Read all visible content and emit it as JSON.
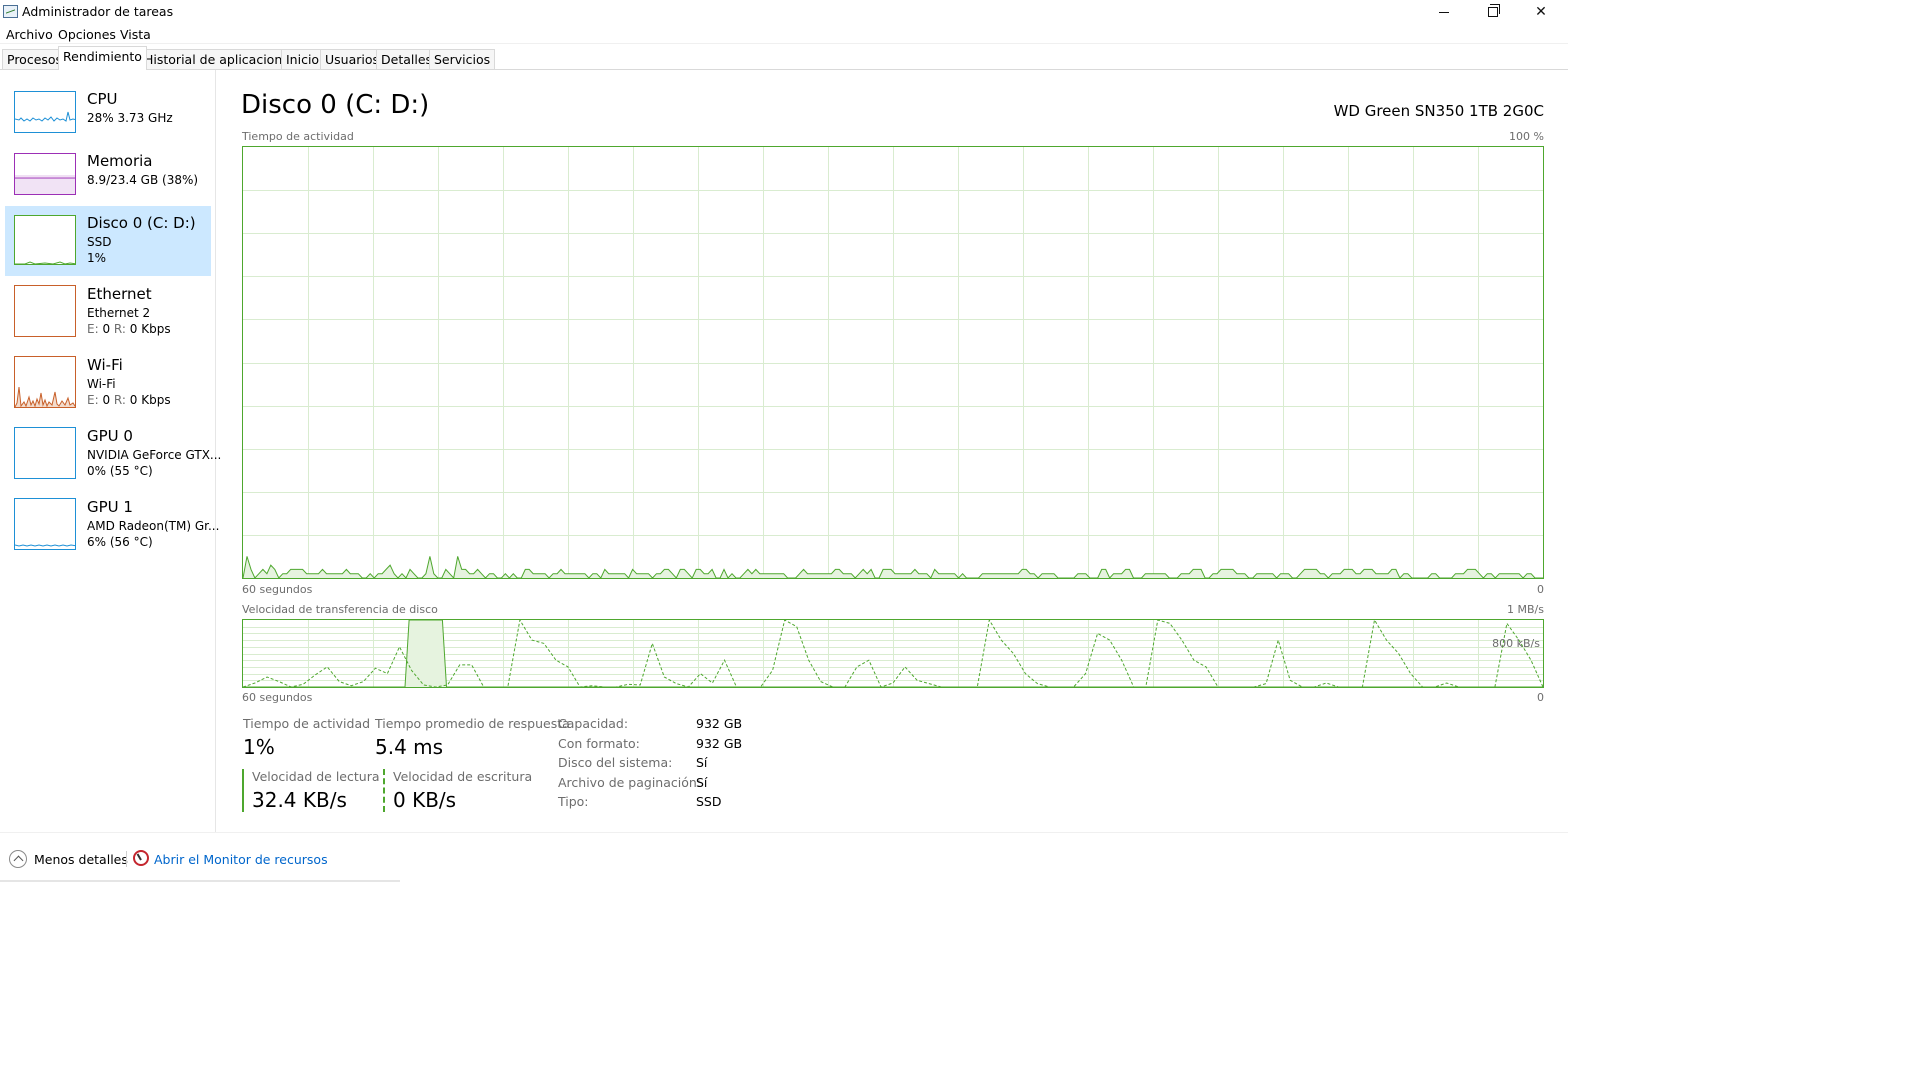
{
  "window": {
    "title": "Administrador de tareas",
    "controls": {
      "minimize": "minimize",
      "restore": "restore",
      "close": "✕"
    }
  },
  "menu": [
    "Archivo",
    "Opciones",
    "Vista"
  ],
  "tabs": [
    "Procesos",
    "Rendimiento",
    "Historial de aplicaciones",
    "Inicio",
    "Usuarios",
    "Detalles",
    "Servicios"
  ],
  "active_tab": "Rendimiento",
  "sidebar": {
    "items": [
      {
        "name": "CPU",
        "line1": "28% 3.73 GHz",
        "color": "#1e90d6"
      },
      {
        "name": "Memoria",
        "line1": "8.9/23.4 GB (38%)",
        "color": "#9c2fb6"
      },
      {
        "name": "Disco 0 (C: D:)",
        "line1": "SSD",
        "line2": "1%",
        "color": "#4ea72e"
      },
      {
        "name": "Ethernet",
        "line1": "Ethernet 2",
        "line2_prefix_e": "E:",
        "line2_e": "0",
        "line2_prefix_r": "R:",
        "line2_r": "0 Kbps",
        "color": "#c8602a"
      },
      {
        "name": "Wi-Fi",
        "line1": "Wi-Fi",
        "line2_prefix_e": "E:",
        "line2_e": "0",
        "line2_prefix_r": "R:",
        "line2_r": "0 Kbps",
        "color": "#c8602a"
      },
      {
        "name": "GPU 0",
        "line1": "NVIDIA GeForce GTX...",
        "line2": "0%  (55 °C)",
        "color": "#1e90d6"
      },
      {
        "name": "GPU 1",
        "line1": "AMD Radeon(TM) Gr...",
        "line2": "6%  (56 °C)",
        "color": "#1e90d6"
      }
    ]
  },
  "main": {
    "title": "Disco 0 (C: D:)",
    "device": "WD Green SN350 1TB 2G0C",
    "chart1": {
      "label": "Tiempo de actividad",
      "max_label": "100 %",
      "time_label": "60 segundos",
      "min_label": "0"
    },
    "chart2": {
      "label": "Velocidad de transferencia de disco",
      "max_label": "1 MB/s",
      "mid_label": "800 kB/s",
      "time_label": "60 segundos",
      "min_label": "0"
    }
  },
  "stats": {
    "active_time_label": "Tiempo de actividad",
    "active_time_value": "1%",
    "response_label": "Tiempo promedio de respuesta",
    "response_value": "5.4 ms",
    "read_label": "Velocidad de lectura",
    "read_value": "32.4 KB/s",
    "write_label": "Velocidad de escritura",
    "write_value": "0 KB/s"
  },
  "properties": [
    {
      "label": "Capacidad:",
      "value": "932 GB"
    },
    {
      "label": "Con formato:",
      "value": "932 GB"
    },
    {
      "label": "Disco del sistema:",
      "value": "Sí"
    },
    {
      "label": "Archivo de paginación:",
      "value": "Sí"
    },
    {
      "label": "Tipo:",
      "value": "SSD"
    }
  ],
  "footer": {
    "fewer_details": "Menos detalles",
    "resource_monitor": "Abrir el Monitor de recursos"
  },
  "chart_data": [
    {
      "type": "area",
      "title": "Tiempo de actividad",
      "ylim": [
        0,
        100
      ],
      "unit": "%",
      "x_span_label": "60 segundos",
      "series": [
        {
          "values": [
            0,
            5,
            2,
            0,
            1,
            2,
            1,
            3,
            2,
            0,
            1,
            1,
            2,
            2,
            2,
            2,
            1,
            1,
            1,
            1,
            2,
            1,
            1,
            1,
            1,
            1,
            2,
            1,
            1,
            1,
            0,
            0,
            1,
            0,
            1,
            1,
            2,
            3,
            1,
            0,
            1,
            0,
            2,
            1,
            0,
            0,
            1,
            5,
            1,
            0,
            0,
            2,
            1,
            0,
            5,
            2,
            2,
            1,
            1,
            2,
            1,
            0,
            1,
            1,
            0,
            0,
            1,
            0,
            1,
            0,
            0,
            2,
            2,
            1,
            1,
            1,
            1,
            0,
            1,
            1,
            2,
            1,
            1,
            1,
            1,
            1,
            1,
            0,
            1,
            1,
            0,
            2,
            1,
            1,
            1,
            1,
            1,
            0,
            2,
            1,
            1,
            1,
            1,
            0,
            1,
            1,
            2,
            2,
            1,
            0,
            2,
            2,
            1,
            0,
            2,
            2,
            1,
            1,
            2,
            0,
            0,
            2,
            0,
            1,
            0,
            0,
            1,
            2,
            1,
            2,
            1,
            1,
            1,
            1,
            1,
            1,
            1,
            0,
            0,
            0,
            1,
            2,
            1,
            1,
            1,
            1,
            1,
            1,
            1,
            2,
            2,
            1,
            1,
            1,
            0,
            1,
            2,
            1,
            2,
            0,
            0,
            2,
            2,
            2,
            1,
            1,
            1,
            1,
            1,
            2,
            1,
            1,
            1,
            0,
            2,
            1,
            1,
            1,
            1,
            1,
            0,
            1,
            0,
            0,
            0,
            0,
            1,
            1,
            1,
            1,
            1,
            1,
            1,
            1,
            1,
            1,
            2,
            2,
            1,
            1,
            0,
            1,
            1,
            1,
            1,
            0,
            0,
            0,
            0,
            0,
            1,
            1,
            1,
            0,
            0,
            0,
            2,
            2,
            0,
            1,
            1,
            1,
            2,
            2,
            0,
            0,
            0,
            1,
            1,
            1,
            1,
            1,
            1,
            0,
            0,
            0,
            1,
            1,
            1,
            2,
            2,
            2,
            0,
            0,
            1,
            1,
            2,
            2,
            2,
            2,
            1,
            1,
            1,
            0,
            0,
            1,
            1,
            1,
            1,
            1,
            0,
            1,
            1,
            1,
            0,
            0,
            1,
            2,
            2,
            2,
            2,
            1,
            1,
            0,
            1,
            1,
            1,
            2,
            2,
            2,
            1,
            1,
            2,
            2,
            2,
            1,
            1,
            1,
            1,
            2,
            2,
            0,
            1,
            1,
            0,
            0,
            0,
            0,
            0,
            1,
            1,
            0,
            0,
            0,
            0,
            1,
            1,
            1,
            2,
            2,
            2,
            1,
            0,
            1,
            1,
            0,
            1,
            1,
            1,
            1,
            1,
            1,
            0,
            1,
            1,
            0,
            0,
            0
          ]
        }
      ]
    },
    {
      "type": "line",
      "title": "Velocidad de transferencia de disco",
      "ylim": [
        0,
        1000
      ],
      "unit": "kB/s",
      "x_span_label": "60 segundos",
      "series": [
        {
          "name": "Velocidad de lectura",
          "style": "solid",
          "values": [
            0,
            0,
            0,
            0,
            0,
            0,
            0,
            0,
            0,
            0,
            0,
            0,
            0,
            0,
            0,
            0,
            0,
            0,
            0,
            0,
            0,
            0,
            0,
            0,
            0,
            0,
            0,
            0,
            0,
            0,
            0,
            0,
            0,
            0,
            0,
            0,
            0,
            0,
            0,
            0,
            1000,
            1000,
            1000,
            1000,
            1000,
            1000,
            1000,
            1000,
            1000,
            0,
            0,
            0,
            0,
            0,
            0,
            0,
            0,
            0,
            0,
            0,
            0,
            0,
            0,
            0,
            0,
            0,
            0,
            0,
            0,
            0,
            0,
            0,
            0,
            0,
            0,
            0,
            0,
            0,
            0,
            0,
            0,
            0,
            0,
            0,
            0,
            0,
            0,
            0,
            0,
            0,
            0,
            0,
            0,
            0,
            0,
            0,
            0,
            0,
            0,
            0,
            0,
            0,
            0,
            0,
            0,
            0,
            0,
            0,
            0,
            0,
            0,
            0,
            0,
            0,
            0,
            0,
            0,
            0,
            0,
            0,
            0,
            0,
            0,
            0,
            0,
            0,
            0,
            0,
            0,
            0,
            0,
            0,
            0,
            0,
            0,
            0,
            0,
            0,
            0,
            0,
            0,
            0,
            0,
            0,
            0,
            0,
            0,
            0,
            0,
            0,
            0,
            0,
            0,
            0,
            0,
            0,
            0,
            0,
            0,
            0,
            0,
            0,
            0,
            0,
            0,
            0,
            0,
            0,
            0,
            0,
            0,
            0,
            0,
            0,
            0,
            0,
            0,
            0,
            0,
            0,
            0,
            0,
            0,
            0,
            0,
            0,
            0,
            0,
            0,
            0,
            0,
            0,
            0,
            0,
            0,
            0,
            0,
            0,
            0,
            0,
            0,
            0,
            0,
            0,
            0,
            0,
            0,
            0,
            0,
            0,
            0,
            0,
            0,
            0,
            0,
            0,
            0,
            0,
            0,
            0,
            0,
            0,
            0,
            0,
            0,
            0,
            0,
            0,
            0,
            0,
            0,
            0,
            0,
            0,
            0,
            0,
            0,
            0,
            0,
            0,
            0,
            0,
            0,
            0,
            0,
            0,
            0,
            0,
            0,
            0,
            0,
            0,
            0,
            0,
            0,
            0,
            0,
            0,
            0,
            0,
            0,
            0,
            0,
            0,
            0,
            0,
            0,
            0,
            0,
            0,
            0,
            0,
            0,
            0,
            0,
            0,
            0,
            0,
            0,
            0,
            0,
            0,
            0,
            0,
            0,
            0,
            0,
            0,
            0,
            0,
            0,
            0,
            0,
            0,
            0,
            0,
            0,
            0,
            0,
            0,
            0,
            0,
            0,
            0,
            0,
            0,
            0,
            0,
            0,
            0,
            0,
            0,
            0,
            0
          ]
        },
        {
          "name": "Velocidad de escritura",
          "style": "dashed",
          "values": [
            0,
            60,
            150,
            80,
            0,
            40,
            180,
            300,
            80,
            20,
            80,
            280,
            200,
            600,
            250,
            30,
            0,
            30,
            330,
            330,
            0,
            0,
            0,
            1000,
            700,
            650,
            400,
            300,
            0,
            20,
            0,
            0,
            40,
            30,
            650,
            150,
            50,
            0,
            200,
            60,
            400,
            0,
            0,
            0,
            250,
            1000,
            900,
            400,
            80,
            0,
            0,
            300,
            400,
            0,
            60,
            300,
            100,
            50,
            0,
            0,
            0,
            0,
            1000,
            700,
            500,
            200,
            50,
            0,
            0,
            0,
            200,
            800,
            700,
            400,
            0,
            0,
            1000,
            950,
            700,
            400,
            300,
            0,
            0,
            0,
            0,
            50,
            700,
            100,
            0,
            0,
            60,
            0,
            0,
            0,
            1000,
            700,
            500,
            200,
            0,
            0,
            60,
            0,
            0,
            0,
            0,
            950,
            700,
            400,
            0
          ]
        }
      ]
    }
  ]
}
